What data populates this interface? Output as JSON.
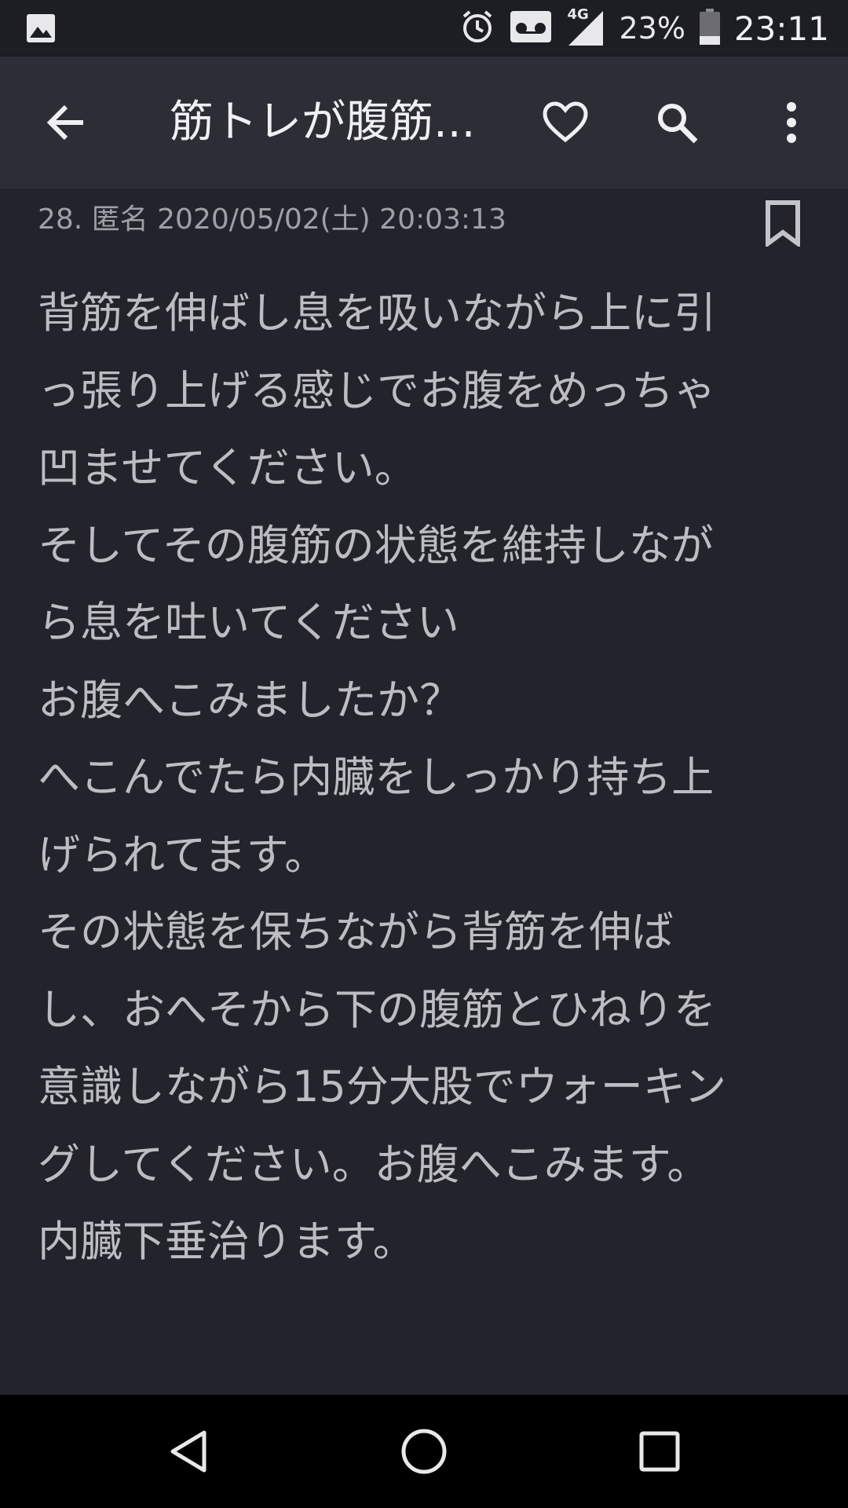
{
  "status_bar": {
    "battery_percent": "23%",
    "time": "23:11",
    "network_label": "4G",
    "icons": [
      "gallery-icon",
      "alarm-icon",
      "voicemail-icon",
      "signal-icon",
      "battery-icon"
    ]
  },
  "app_bar": {
    "title": "筋トレが腹筋...",
    "icons": [
      "back-arrow-icon",
      "heart-icon",
      "search-icon",
      "more-vert-icon"
    ]
  },
  "post": {
    "header": "28. 匿名 2020/05/02(土) 20:03:13",
    "lines": [
      "背筋を伸ばし息を吸いながら上に引",
      "っ張り上げる感じでお腹をめっちゃ",
      "凹ませてください。",
      "そしてその腹筋の状態を維持しなが",
      "ら息を吐いてください",
      "お腹へこみましたか？",
      "へこんでたら内臓をしっかり持ち上",
      "げられてます。",
      "その状態を保ちながら背筋を伸ば",
      "し、おへそから下の腹筋とひねりを",
      "意識しながら15分大股でウォーキン",
      "グしてください。お腹へこみます。",
      "内臓下垂治ります。"
    ]
  },
  "nav_bar": {
    "icons": [
      "nav-back-icon",
      "nav-home-icon",
      "nav-recents-icon"
    ]
  },
  "colors": {
    "background": "#22232b",
    "app_bar": "#2c2d35",
    "text": "#bcbcc1",
    "meta_text": "#9fa0a6"
  }
}
